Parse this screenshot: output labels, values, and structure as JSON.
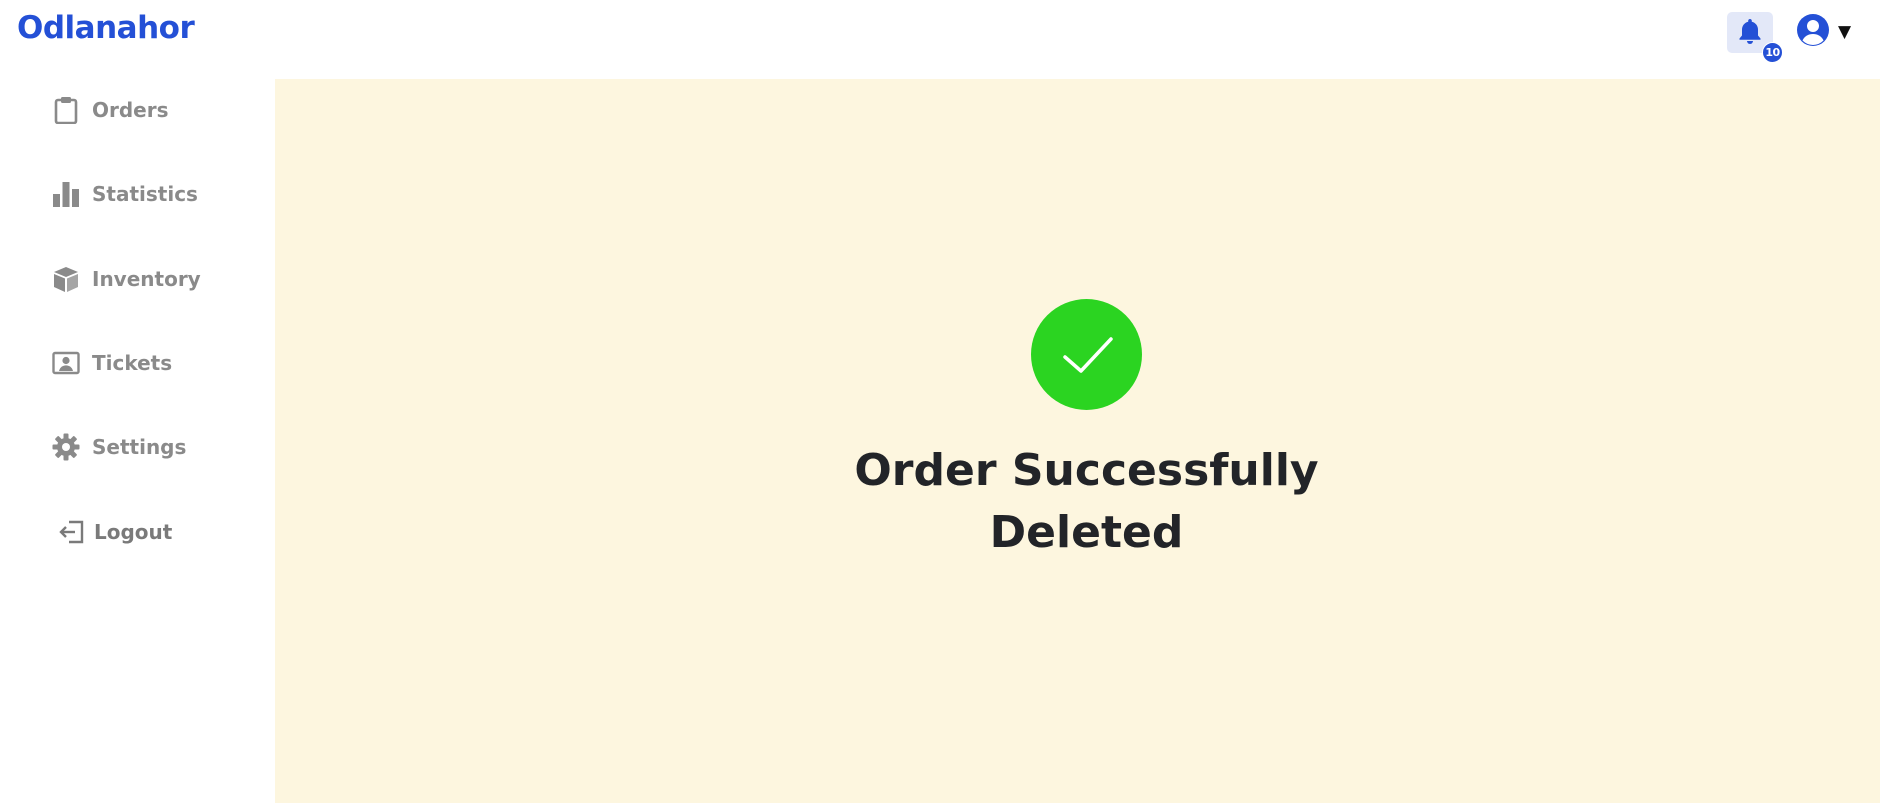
{
  "app": {
    "brand": "Odlanahor",
    "brand_color": "#2450d6"
  },
  "header": {
    "notifications": {
      "icon": "bell-icon",
      "count": "10"
    },
    "user": {
      "icon": "user-circle-icon",
      "caret": "▼"
    }
  },
  "sidebar": {
    "items": [
      {
        "label": "Orders",
        "icon": "clipboard-icon"
      },
      {
        "label": "Statistics",
        "icon": "bar-chart-icon"
      },
      {
        "label": "Inventory",
        "icon": "box-icon"
      },
      {
        "label": "Tickets",
        "icon": "ticket-user-icon"
      },
      {
        "label": "Settings",
        "icon": "gear-icon"
      },
      {
        "label": "Logout",
        "icon": "logout-icon"
      }
    ]
  },
  "main": {
    "status": {
      "icon": "check-circle-icon",
      "color": "#2bd421",
      "message": "Order Successfully Deleted"
    }
  },
  "colors": {
    "content_bg": "#fdf6df",
    "nav_text": "#8a8a8a",
    "title_text": "#222428"
  }
}
